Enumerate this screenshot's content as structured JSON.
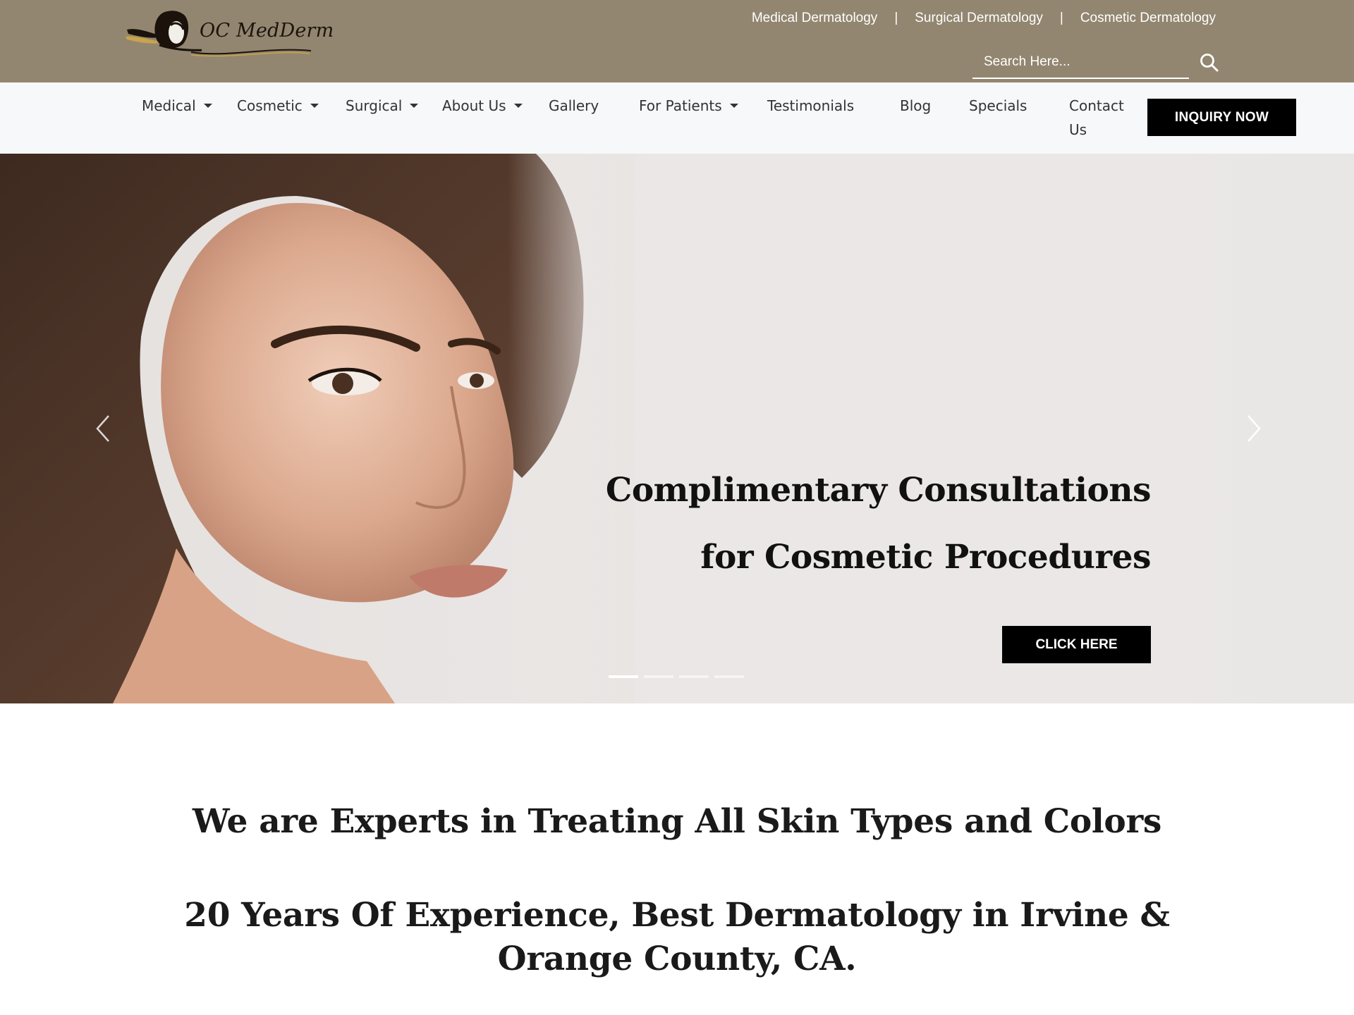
{
  "brand": {
    "name": "OC MedDerm"
  },
  "top_links": [
    "Medical Dermatology",
    "Surgical Dermatology",
    "Cosmetic Dermatology"
  ],
  "top_separator": "|",
  "search": {
    "placeholder": "Search Here..."
  },
  "nav": {
    "medical": "Medical",
    "cosmetic": "Cosmetic",
    "surgical": "Surgical",
    "about": "About Us",
    "gallery": "Gallery",
    "for_patients": "For Patients",
    "testimonials": "Testimonials",
    "blog": "Blog",
    "specials": "Specials",
    "contact": "Contact Us",
    "inquiry": "INQUIRY NOW"
  },
  "hero": {
    "line1": "Complimentary Consultations",
    "line2": "for Cosmetic Procedures",
    "cta": "CLICK HERE",
    "slide_count": 4,
    "active_slide": 1
  },
  "content": {
    "headline1": "We are Experts in Treating All Skin Types and Colors",
    "headline2": "20 Years Of Experience, Best Dermatology in Irvine & Orange County, CA."
  },
  "colors": {
    "topbar": "#938670",
    "nav_bg": "#f7f8fa",
    "button": "#000000",
    "hero_bg": "#e9e6e5"
  },
  "icons": [
    "logo-hair-icon",
    "search-icon",
    "caret-down-icon",
    "arrow-left-icon",
    "arrow-right-icon"
  ]
}
